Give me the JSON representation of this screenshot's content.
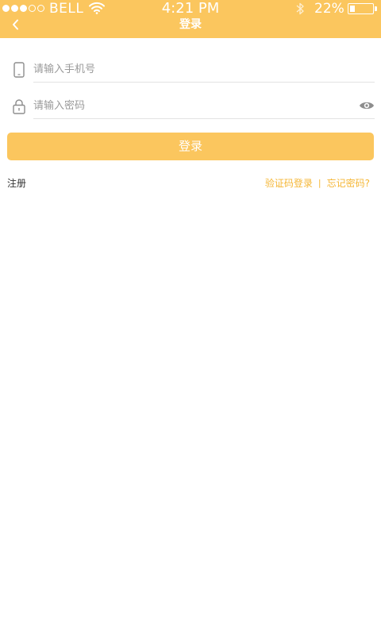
{
  "status_bar": {
    "carrier": "BELL",
    "time": "4:21 PM",
    "battery_percent": "22%",
    "battery_level": 0.22,
    "signal_bars_filled": 3,
    "signal_bars_total": 5
  },
  "nav": {
    "title": "登录",
    "back_icon": "chevron-left-icon"
  },
  "form": {
    "phone_placeholder": "请输入手机号",
    "phone_value": "",
    "phone_icon": "phone-icon",
    "password_placeholder": "请输入密码",
    "password_value": "",
    "password_icon": "lock-icon",
    "toggle_icon": "eye-icon"
  },
  "login_button": "登录",
  "links": {
    "register": "注册",
    "sms_login": "验证码登录",
    "separator": "|",
    "forgot_password": "忘记密码?"
  },
  "colors": {
    "accent": "#FBC65E",
    "link": "#F5B634"
  }
}
